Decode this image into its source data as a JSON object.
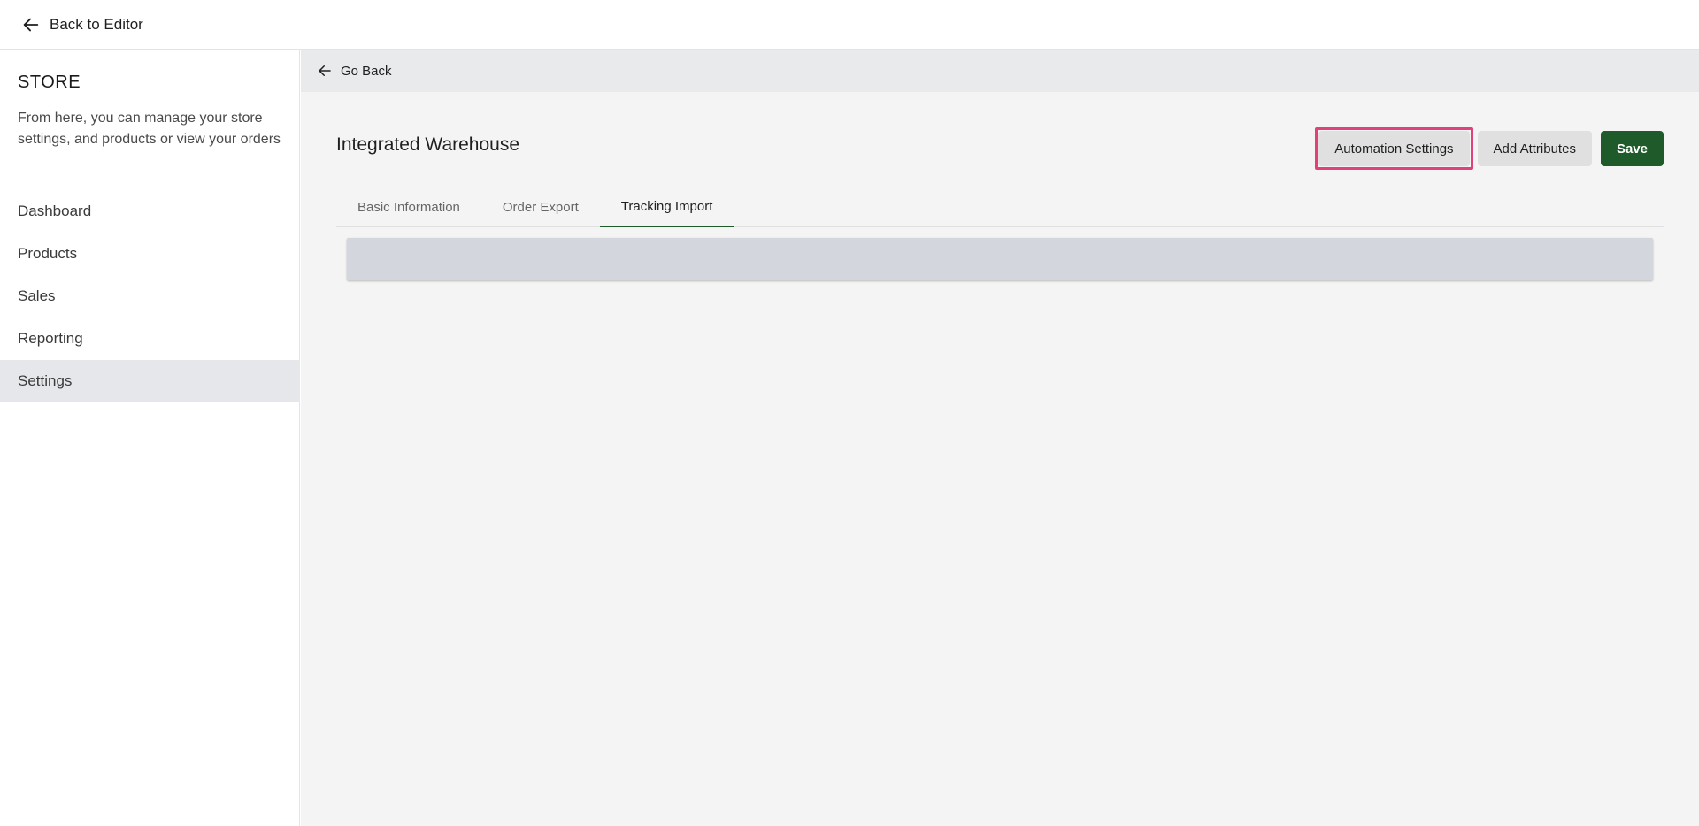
{
  "topbar": {
    "back_label": "Back to Editor"
  },
  "sidebar": {
    "title": "STORE",
    "description": "From here, you can manage your store settings, and products or view your orders",
    "items": [
      {
        "label": "Dashboard"
      },
      {
        "label": "Products"
      },
      {
        "label": "Sales"
      },
      {
        "label": "Reporting"
      },
      {
        "label": "Settings",
        "active": true
      }
    ]
  },
  "main": {
    "go_back_label": "Go Back",
    "title": "Integrated Warehouse",
    "actions": {
      "automation_label": "Automation Settings",
      "add_attributes_label": "Add Attributes",
      "save_label": "Save"
    },
    "tabs": [
      {
        "label": "Basic Information"
      },
      {
        "label": "Order Export"
      },
      {
        "label": "Tracking Import",
        "active": true
      }
    ]
  },
  "colors": {
    "accent": "#1f5b2a",
    "highlight": "#e2407a",
    "active_nav_bg": "#e6e7ea"
  },
  "icons": {
    "back": "arrow-left-icon"
  }
}
